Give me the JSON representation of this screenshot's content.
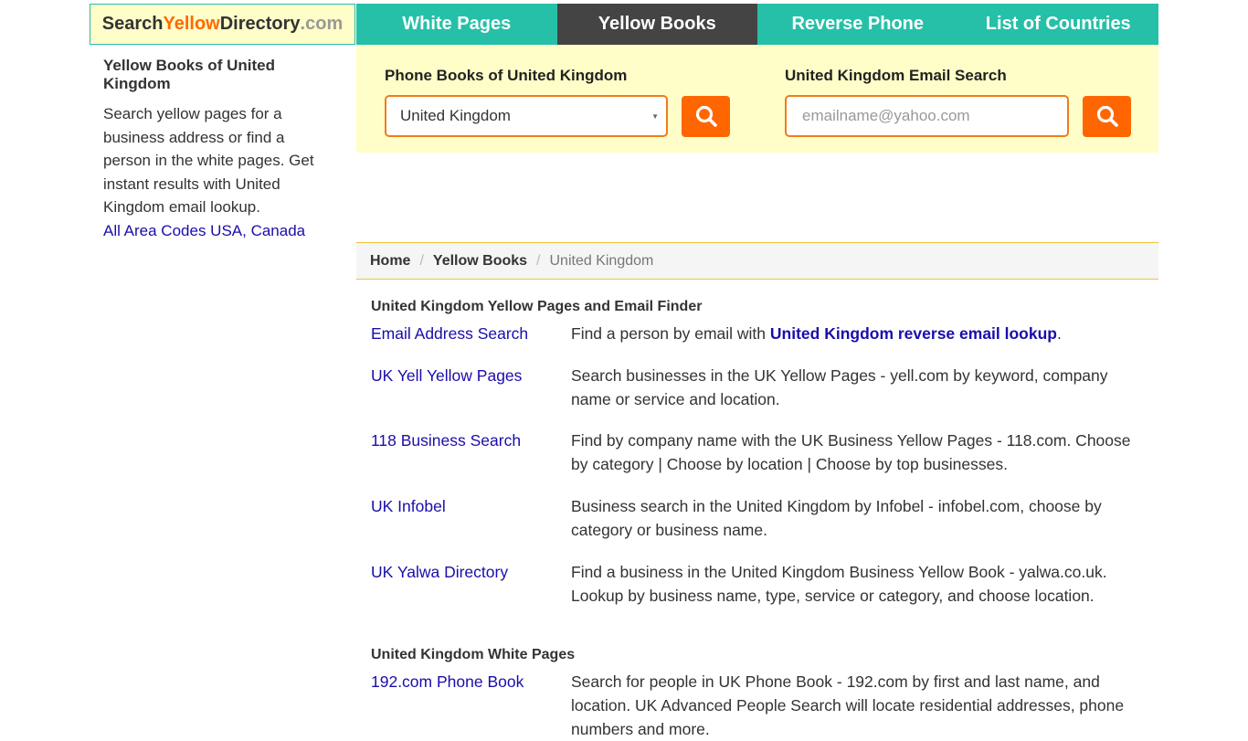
{
  "logo": {
    "part1": "Search",
    "part2": "Yellow",
    "part3": "Directory",
    "part4": ".com"
  },
  "nav": [
    {
      "label": "White Pages"
    },
    {
      "label": "Yellow Books"
    },
    {
      "label": "Reverse Phone"
    },
    {
      "label": "List of Countries"
    }
  ],
  "sidebar": {
    "title": "Yellow Books of United Kingdom",
    "text": "Search yellow pages for a business address or find a person in the white pages. Get instant results with United Kingdom email lookup.",
    "link": "All Area Codes USA, Canada"
  },
  "phone_search": {
    "title": "Phone Books of United Kingdom",
    "selected": "United Kingdom"
  },
  "email_search": {
    "title": "United Kingdom Email Search",
    "placeholder": "emailname@yahoo.com"
  },
  "breadcrumb": {
    "home": "Home",
    "yellow": "Yellow Books",
    "current": "United Kingdom"
  },
  "yellow_section": {
    "title": "United Kingdom Yellow Pages and Email Finder",
    "email_entry": {
      "link": "Email Address Search",
      "desc_prefix": "Find a person by email with ",
      "desc_link": "United Kingdom reverse email lookup",
      "desc_suffix": "."
    },
    "entries": [
      {
        "link": "UK Yell Yellow Pages",
        "desc": "Search businesses in the UK Yellow Pages - yell.com by keyword, company name or service and location."
      },
      {
        "link": "118 Business Search",
        "desc": "Find by company name with the UK Business Yellow Pages - 118.com. Choose by category | Choose by location | Choose by top businesses."
      },
      {
        "link": "UK Infobel",
        "desc": "Business search in the United Kingdom by Infobel - infobel.com, choose by category or business name."
      },
      {
        "link": "UK Yalwa Directory",
        "desc": "Find a business in the United Kingdom Business Yellow Book - yalwa.co.uk. Lookup by business name, type, service or category, and choose location."
      }
    ]
  },
  "white_section": {
    "title": "United Kingdom White Pages",
    "entries": [
      {
        "link": "192.com Phone Book",
        "desc": "Search for people in UK Phone Book - 192.com by first and last name, and location. UK Advanced People Search will locate residential addresses, phone numbers and more."
      }
    ]
  },
  "colors": {
    "teal": "#26c0a8",
    "active_tab": "#444444",
    "orange": "#ff6600",
    "panel_bg": "#fffec8",
    "link": "#1a0dab"
  },
  "icons": {
    "search_button": "search-icon",
    "dropdown": "caret-down-icon"
  }
}
